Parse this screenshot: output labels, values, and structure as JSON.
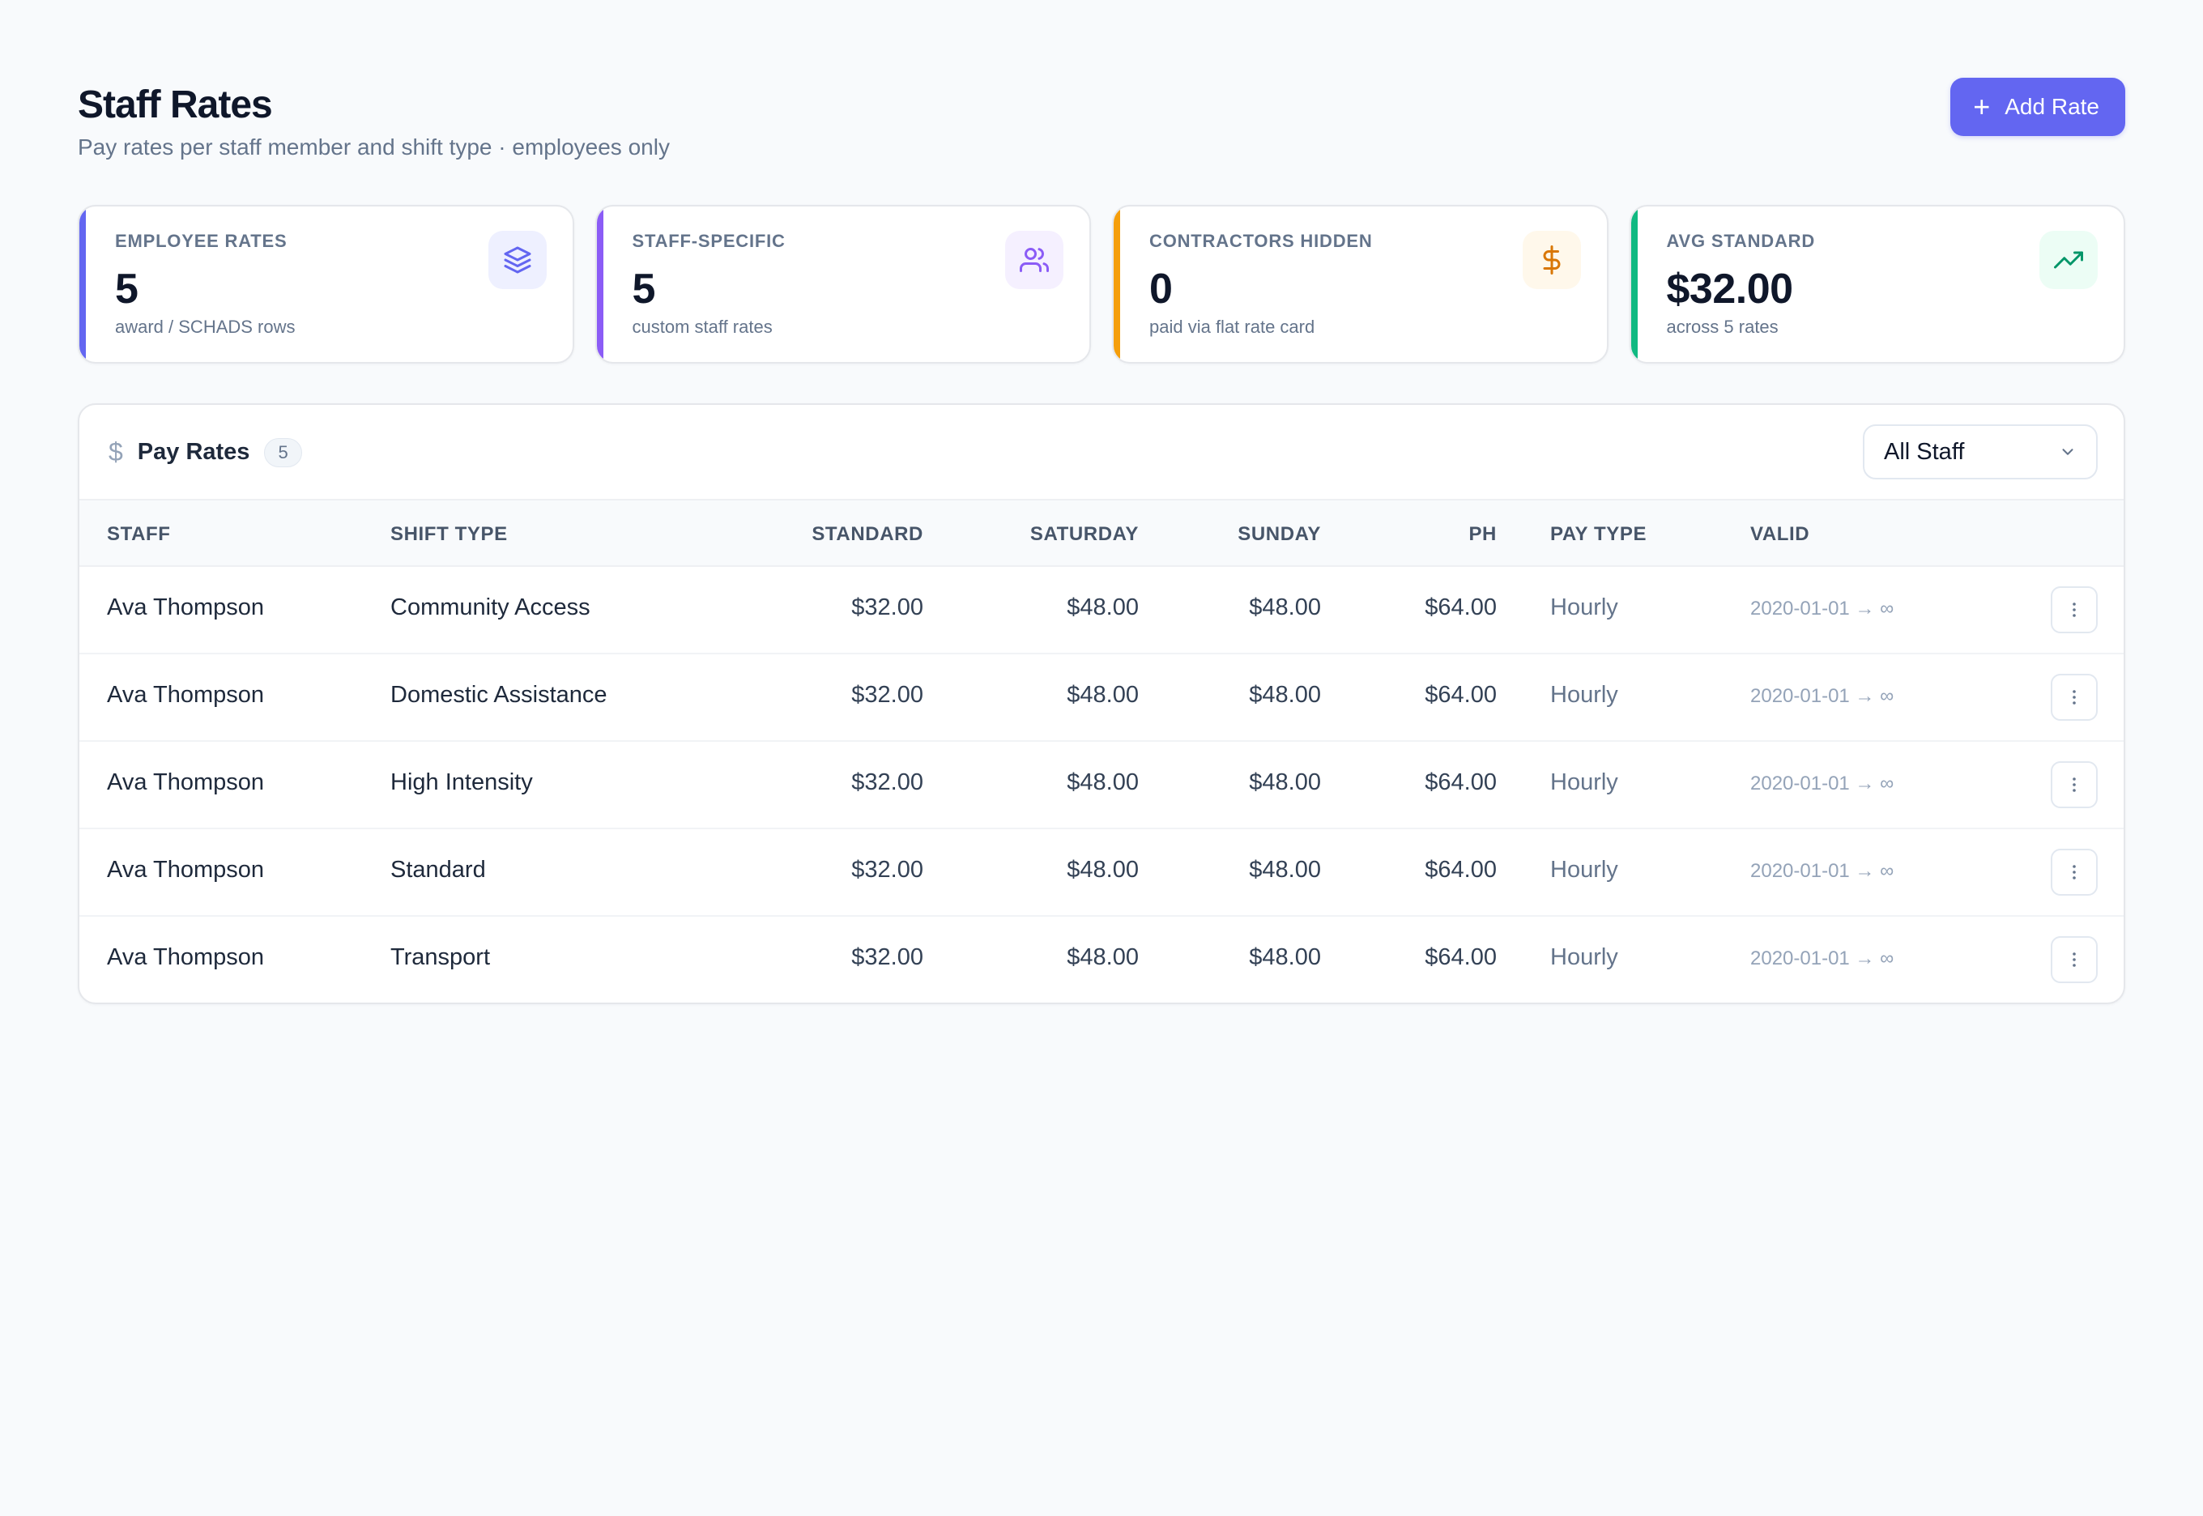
{
  "header": {
    "title": "Staff Rates",
    "subtitle": "Pay rates per staff member and shift type · employees only",
    "add_label": "Add Rate"
  },
  "stats": [
    {
      "label": "EMPLOYEE RATES",
      "value": "5",
      "note": "award / SCHADS rows",
      "accent": "#6366f1",
      "icon": "layers-icon",
      "icon_bg": "#eef0ff",
      "icon_color": "#6366f1"
    },
    {
      "label": "STAFF-SPECIFIC",
      "value": "5",
      "note": "custom staff rates",
      "accent": "#8b5cf6",
      "icon": "users-icon",
      "icon_bg": "#f5f0ff",
      "icon_color": "#8b5cf6"
    },
    {
      "label": "CONTRACTORS HIDDEN",
      "value": "0",
      "note": "paid via flat rate card",
      "accent": "#f59e0b",
      "icon": "dollar-icon",
      "icon_bg": "#fff8eb",
      "icon_color": "#d97706"
    },
    {
      "label": "AVG STANDARD",
      "value": "$32.00",
      "note": "across 5 rates",
      "accent": "#10b981",
      "icon": "trending-up-icon",
      "icon_bg": "#ecfdf5",
      "icon_color": "#059669"
    }
  ],
  "table": {
    "title": "Pay Rates",
    "count": "5",
    "filter_value": "All Staff",
    "columns": [
      "STAFF",
      "SHIFT TYPE",
      "STANDARD",
      "SATURDAY",
      "SUNDAY",
      "PH",
      "PAY TYPE",
      "VALID"
    ],
    "rows": [
      {
        "staff": "Ava Thompson",
        "shift": "Community Access",
        "standard": "$32.00",
        "saturday": "$48.00",
        "sunday": "$48.00",
        "ph": "$64.00",
        "pay_type": "Hourly",
        "valid": "2020-01-01 → ∞"
      },
      {
        "staff": "Ava Thompson",
        "shift": "Domestic Assistance",
        "standard": "$32.00",
        "saturday": "$48.00",
        "sunday": "$48.00",
        "ph": "$64.00",
        "pay_type": "Hourly",
        "valid": "2020-01-01 → ∞"
      },
      {
        "staff": "Ava Thompson",
        "shift": "High Intensity",
        "standard": "$32.00",
        "saturday": "$48.00",
        "sunday": "$48.00",
        "ph": "$64.00",
        "pay_type": "Hourly",
        "valid": "2020-01-01 → ∞"
      },
      {
        "staff": "Ava Thompson",
        "shift": "Standard",
        "standard": "$32.00",
        "saturday": "$48.00",
        "sunday": "$48.00",
        "ph": "$64.00",
        "pay_type": "Hourly",
        "valid": "2020-01-01 → ∞"
      },
      {
        "staff": "Ava Thompson",
        "shift": "Transport",
        "standard": "$32.00",
        "saturday": "$48.00",
        "sunday": "$48.00",
        "ph": "$64.00",
        "pay_type": "Hourly",
        "valid": "2020-01-01 → ∞"
      }
    ]
  }
}
